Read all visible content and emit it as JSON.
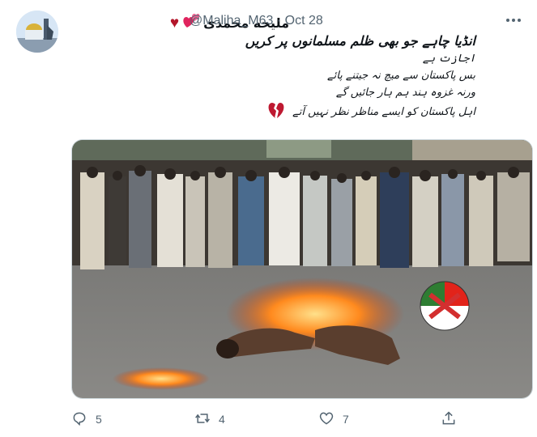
{
  "tweet": {
    "display_name": "ملیحه محمدی",
    "handle": "@Maliha_M63",
    "separator": "·",
    "date": "Oct 28",
    "text_title": "انڈیا چاہے جو بھی ظلم مسلمانوں پر کریں",
    "text_lines": [
      "اجازت ہے",
      "بس پاکستان سے میچ نہ جیتنے پائے",
      "ورنہ غزوہ ہند ہم ہار جائیں گے",
      "اہل پاکستان کو ایسے مناظر نظر نہیں آتے"
    ]
  },
  "actions": {
    "reply_count": "5",
    "retweet_count": "4",
    "like_count": "7"
  },
  "icons": {
    "hearts": [
      "heart-icon",
      "two-hearts-icon"
    ],
    "broken_heart": "broken-heart-icon",
    "more": "more-icon",
    "reply": "reply-icon",
    "retweet": "retweet-icon",
    "like": "like-icon",
    "share": "share-icon"
  },
  "colors": {
    "secondary_text": "#536471",
    "heart": "#e0245e"
  }
}
